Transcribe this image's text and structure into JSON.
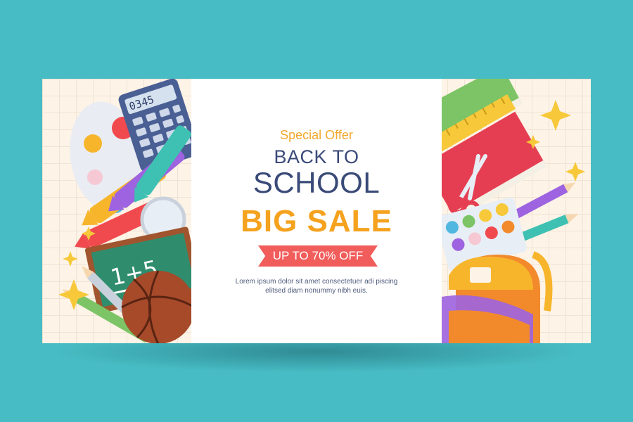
{
  "banner": {
    "special_offer": "Special Offer",
    "title_line1": "BACK TO",
    "title_line2": "SCHOOL",
    "headline": "BIG SALE",
    "discount": "UP TO 70% OFF",
    "body_text": "Lorem ipsum dolor sit amet consectetuer adi piscing elitsed diam nonummy nibh euis."
  },
  "illustration": {
    "calculator_display": "0345",
    "chalkboard_text": "1+5"
  },
  "colors": {
    "background": "#47bcc4",
    "headline": "#f5a21f",
    "title": "#3a4a78",
    "ribbon": "#f05d5b",
    "special_offer": "#f2a72c"
  }
}
